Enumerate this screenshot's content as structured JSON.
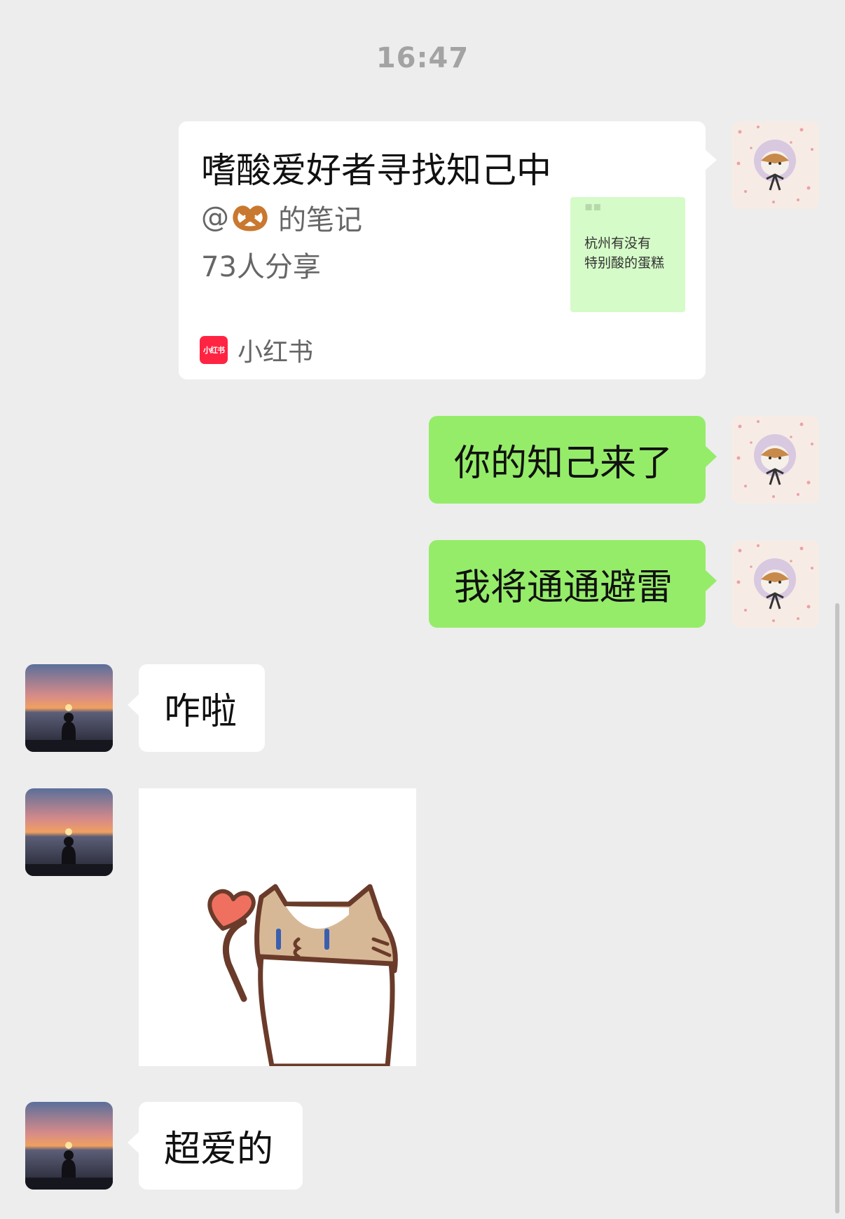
{
  "timestamp": "16:47",
  "shared_card": {
    "title": "嗜酸爱好者寻找知己中",
    "author_prefix": "@",
    "author_suffix": "的笔记",
    "shares": "73人分享",
    "thumbnail_lines": [
      "杭州有没有",
      "特别酸的蛋糕"
    ],
    "source_logo_text": "小红书",
    "source_name": "小红书"
  },
  "messages": [
    {
      "sender": "me",
      "text": "你的知己来了"
    },
    {
      "sender": "me",
      "text": "我将通通避雷"
    },
    {
      "sender": "other",
      "text": "咋啦"
    },
    {
      "sender": "other",
      "type": "sticker",
      "icon": "cat-heart-sticker"
    },
    {
      "sender": "other",
      "text": "超爱的"
    }
  ],
  "colors": {
    "background": "#ededed",
    "my_bubble": "#95ec69",
    "other_bubble": "#ffffff",
    "xhs_red": "#ff2442"
  }
}
